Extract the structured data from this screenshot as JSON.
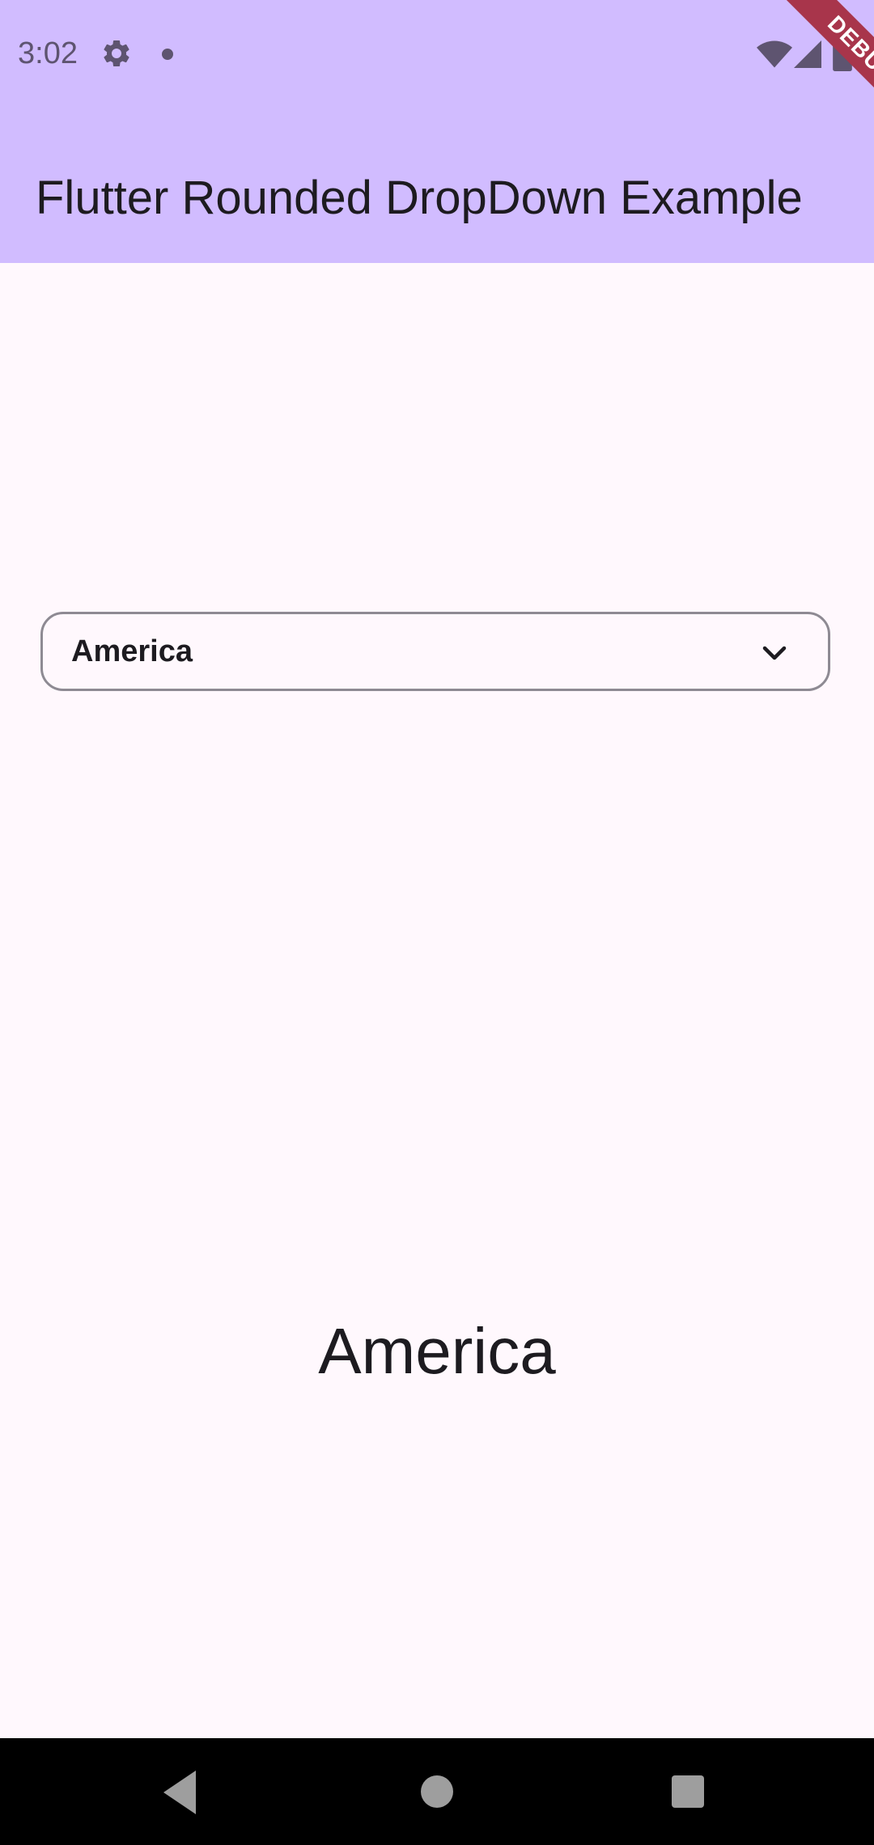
{
  "status_bar": {
    "time": "3:02",
    "icons": [
      "gear-icon",
      "notification-dot-icon",
      "wifi-icon",
      "signal-icon",
      "battery-icon"
    ]
  },
  "debug_banner": {
    "label": "DEBUG"
  },
  "app_bar": {
    "title": "Flutter Rounded DropDown Example"
  },
  "dropdown": {
    "selected_value": "America",
    "icon": "chevron-down-icon"
  },
  "selected_display": {
    "text": "America"
  },
  "navigation_bar": {
    "icons": [
      "back-icon",
      "home-icon",
      "recents-icon"
    ]
  },
  "colors": {
    "app_bar_background": "#D1BCFF",
    "page_background": "#FFF8FD",
    "text": "#1D1B20",
    "outline": "#8E8A93",
    "debug_ribbon": "#A8354B",
    "nav_bar": "#000000"
  }
}
